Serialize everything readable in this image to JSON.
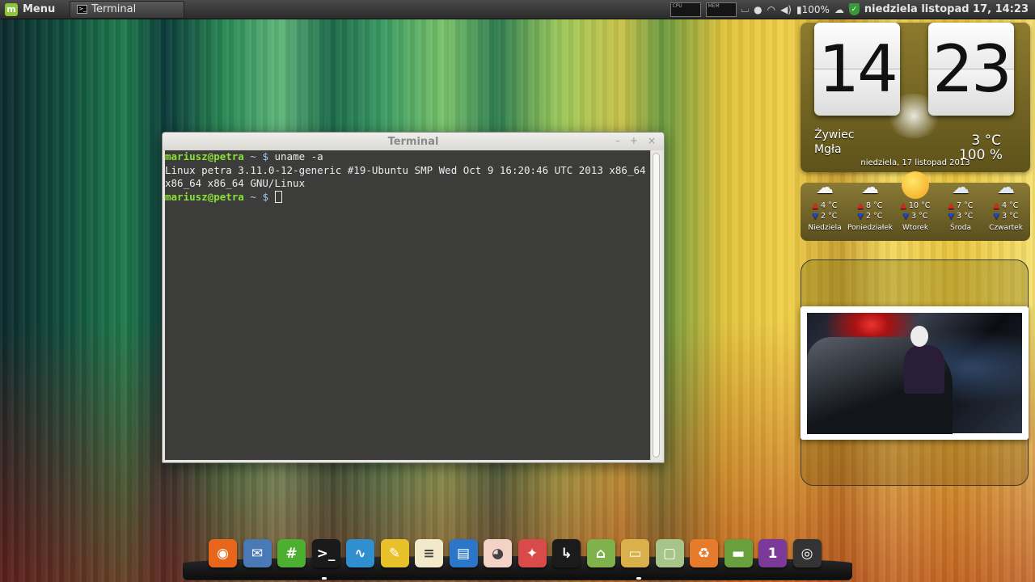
{
  "top_panel": {
    "menu_label": "Menu",
    "window_button": "Terminal",
    "cpu_label": "CPU",
    "mem_label": "MEM",
    "battery": "100%",
    "clock": "niedziela listopad 17, 14:23"
  },
  "terminal": {
    "title": "Terminal",
    "controls": {
      "minimize": "–",
      "maximize": "+",
      "close": "×"
    },
    "prompt_user": "mariusz@petra",
    "prompt_dir": "~",
    "prompt_symbol": "$",
    "command": "uname -a",
    "output": "Linux petra 3.11.0-12-generic #19-Ubuntu SMP Wed Oct 9 16:20:46 UTC 2013 x86_64 x86_64 x86_64 GNU/Linux"
  },
  "clock_widget": {
    "hour": "14",
    "minute": "23",
    "city": "Żywiec",
    "condition": "Mgła",
    "temperature": "3 °C",
    "humidity": "100 %",
    "date": "niedziela, 17 listopad 2013"
  },
  "forecast": [
    {
      "day": "Niedziela",
      "high": "4 °C",
      "low": "2 °C",
      "icon": "cloud-icon"
    },
    {
      "day": "Poniedziałek",
      "high": "8 °C",
      "low": "2 °C",
      "icon": "cloud-icon"
    },
    {
      "day": "Wtorek",
      "high": "10 °C",
      "low": "3 °C",
      "icon": "sun-icon"
    },
    {
      "day": "Środa",
      "high": "7 °C",
      "low": "3 °C",
      "icon": "snow-icon"
    },
    {
      "day": "Czwartek",
      "high": "4 °C",
      "low": "3 °C",
      "icon": "snow-icon"
    }
  ],
  "dock": [
    {
      "name": "firefox",
      "color": "#e8661c",
      "glyph": "◉"
    },
    {
      "name": "thunderbird",
      "color": "#4a7ab5",
      "glyph": "✉"
    },
    {
      "name": "hexchat",
      "color": "#4caf30",
      "glyph": "#"
    },
    {
      "name": "terminal",
      "color": "#1a1a1a",
      "glyph": ">_"
    },
    {
      "name": "system-monitor",
      "color": "#2f8fcf",
      "glyph": "∿"
    },
    {
      "name": "text-editor",
      "color": "#e7c02a",
      "glyph": "✎"
    },
    {
      "name": "notes",
      "color": "#f1e9c9",
      "glyph": "≡"
    },
    {
      "name": "writer",
      "color": "#2c76c7",
      "glyph": "▤"
    },
    {
      "name": "eye-of-gnome",
      "color": "#f3d3c6",
      "glyph": "◕"
    },
    {
      "name": "settings-tool",
      "color": "#d94a4a",
      "glyph": "✦"
    },
    {
      "name": "xterm",
      "color": "#1b1b1b",
      "glyph": "↳"
    },
    {
      "name": "home-folder",
      "color": "#7fb24a",
      "glyph": "⌂"
    },
    {
      "name": "media-folder",
      "color": "#d9b04a",
      "glyph": "▭"
    },
    {
      "name": "files-folder",
      "color": "#a7c489",
      "glyph": "▢"
    },
    {
      "name": "trash",
      "color": "#e57b2b",
      "glyph": "♻"
    },
    {
      "name": "desktop-folder",
      "color": "#6a9f3e",
      "glyph": "▬"
    },
    {
      "name": "workspace-switcher",
      "color": "#7b3a9a",
      "glyph": "1"
    },
    {
      "name": "speaker",
      "color": "#333333",
      "glyph": "◎"
    }
  ]
}
